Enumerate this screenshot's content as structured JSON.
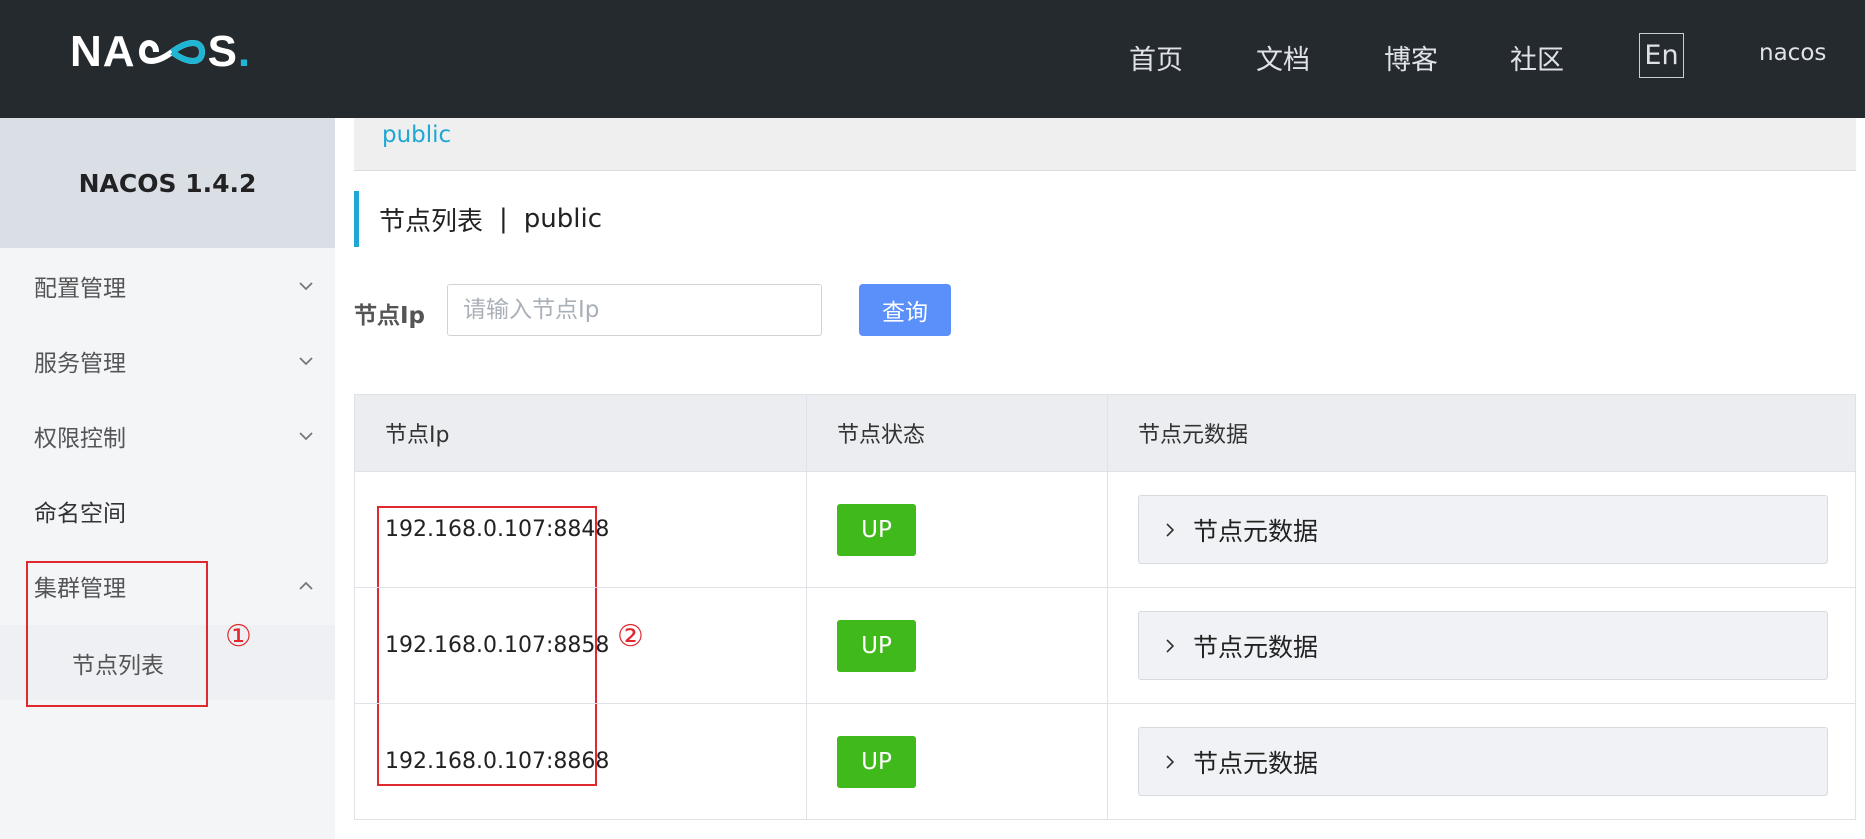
{
  "header": {
    "logo_text_left": "NA",
    "logo_text_right": "S",
    "logo_dot": ".",
    "nav": [
      "首页",
      "文档",
      "博客",
      "社区"
    ],
    "lang_button": "En",
    "username": "nacos"
  },
  "sidebar": {
    "version": "NACOS 1.4.2",
    "items": [
      {
        "label": "配置管理",
        "icon": "chevron-down-icon"
      },
      {
        "label": "服务管理",
        "icon": "chevron-down-icon"
      },
      {
        "label": "权限控制",
        "icon": "chevron-down-icon"
      },
      {
        "label": "命名空间"
      },
      {
        "label": "集群管理",
        "icon": "chevron-up-icon"
      }
    ],
    "subitem": "节点列表"
  },
  "annotations": {
    "marker1": "①",
    "marker2": "②",
    "color": "#e0292e"
  },
  "main": {
    "namespace_tab": "public",
    "title": "节点列表",
    "title_sep": "|",
    "title_namespace": "public",
    "filter": {
      "label": "节点Ip",
      "placeholder": "请输入节点Ip",
      "button": "查询"
    },
    "table": {
      "headers": [
        "节点Ip",
        "节点状态",
        "节点元数据"
      ],
      "rows": [
        {
          "ip": "192.168.0.107:8848",
          "status": "UP",
          "meta": "节点元数据"
        },
        {
          "ip": "192.168.0.107:8858",
          "status": "UP",
          "meta": "节点元数据"
        },
        {
          "ip": "192.168.0.107:8868",
          "status": "UP",
          "meta": "节点元数据"
        }
      ]
    }
  },
  "colors": {
    "topbar": "#252a2f",
    "accent": "#1fa7d4",
    "primary_button": "#5b8ff9",
    "status_up": "#40ba1a"
  }
}
